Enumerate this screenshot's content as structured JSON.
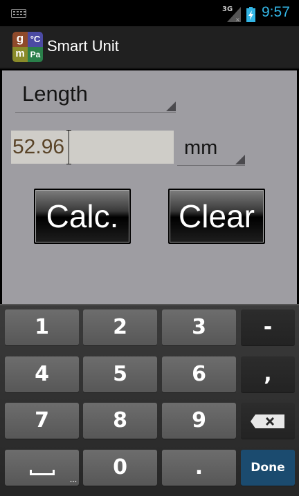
{
  "status_bar": {
    "network_type": "3G",
    "time": "9:57",
    "icons": [
      "keyboard-icon",
      "signal-icon",
      "battery-charging-icon"
    ],
    "clock_color": "#33b5e5"
  },
  "action_bar": {
    "title": "Smart Unit",
    "logo_letters": {
      "top_left": "g",
      "top_right": "°C",
      "bottom_left": "m",
      "bottom_right": "Pa"
    }
  },
  "converter": {
    "category": "Length",
    "input_value": "52.96",
    "unit": "mm",
    "calc_label": "Calc.",
    "clear_label": "Clear"
  },
  "keyboard": {
    "rows": [
      [
        "1",
        "2",
        "3",
        "-"
      ],
      [
        "4",
        "5",
        "6",
        ","
      ],
      [
        "7",
        "8",
        "9",
        "⌫"
      ],
      [
        "space",
        "0",
        ".",
        "Done"
      ]
    ],
    "space_hint": "...",
    "done_color": "#1b4b6f"
  }
}
